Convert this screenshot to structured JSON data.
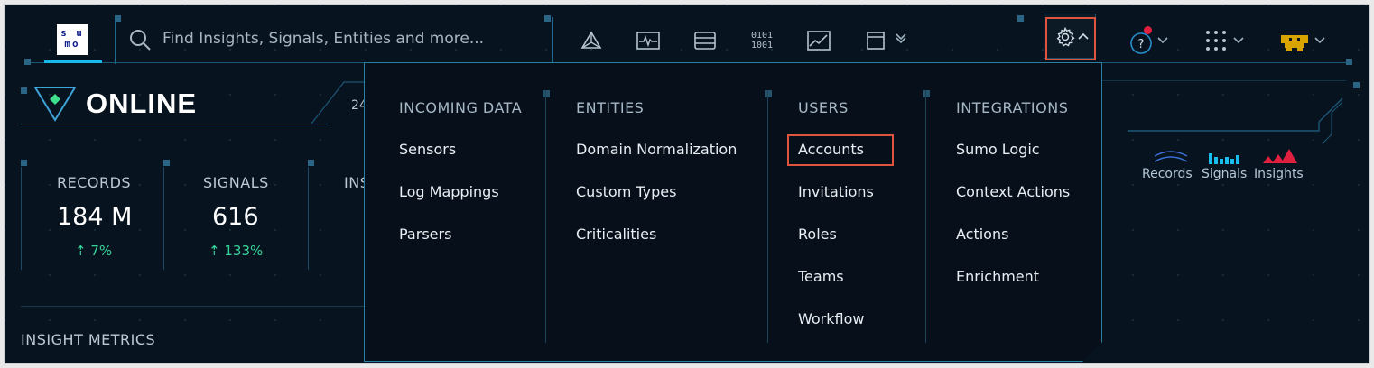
{
  "logo": {
    "text_top": "s u",
    "text_bottom": "mo"
  },
  "search": {
    "placeholder": "Find Insights, Signals, Entities and more..."
  },
  "nav": {
    "icons": [
      "graph-icon",
      "pulse-icon",
      "database-icon",
      "binary-icon",
      "chart-icon",
      "window-icon"
    ],
    "gear": "gear-icon",
    "help": "help-icon",
    "apps": "apps-grid-icon",
    "user": "user-avatar-icon"
  },
  "dashboard": {
    "status_title": "ONLINE",
    "partial_header": "24",
    "stats": [
      {
        "label": "RECORDS",
        "value": "184 M",
        "change": "7%"
      },
      {
        "label": "SIGNALS",
        "value": "616",
        "change": "133%"
      }
    ],
    "partial_stat_label": "INS",
    "insight_metrics_label": "INSIGHT METRICS",
    "legend": [
      "Records",
      "Signals",
      "Insights"
    ]
  },
  "dropdown": {
    "columns": [
      {
        "heading": "INCOMING DATA",
        "items": [
          "Sensors",
          "Log Mappings",
          "Parsers"
        ]
      },
      {
        "heading": "ENTITIES",
        "items": [
          "Domain Normalization",
          "Custom Types",
          "Criticalities"
        ]
      },
      {
        "heading": "USERS",
        "items": [
          "Accounts",
          "Invitations",
          "Roles",
          "Teams",
          "Workflow"
        ]
      },
      {
        "heading": "INTEGRATIONS",
        "items": [
          "Sumo Logic",
          "Context Actions",
          "Actions",
          "Enrichment"
        ]
      }
    ]
  },
  "colors": {
    "accent": "#16b9ea",
    "highlight": "#e0533f",
    "positive": "#36d39a",
    "alert": "#e1203f",
    "avatar": "#d8a400"
  }
}
